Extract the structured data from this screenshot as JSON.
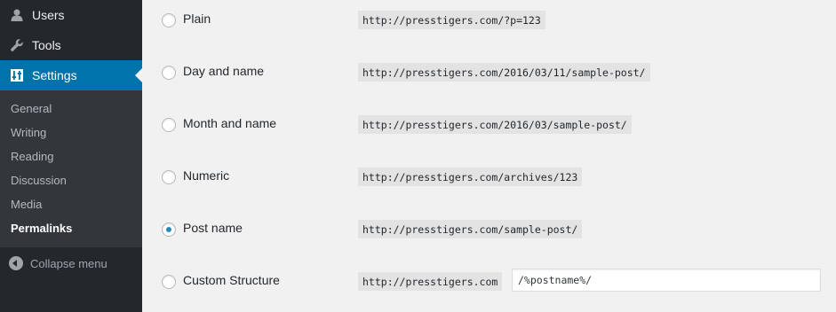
{
  "sidebar": {
    "top_items": [
      {
        "label": "Users",
        "icon": "user-icon"
      },
      {
        "label": "Tools",
        "icon": "wrench-icon"
      },
      {
        "label": "Settings",
        "icon": "settings-icon",
        "active": true
      }
    ],
    "submenu": [
      "General",
      "Writing",
      "Reading",
      "Discussion",
      "Media",
      "Permalinks"
    ],
    "current_submenu": "Permalinks",
    "collapse_label": "Collapse menu"
  },
  "permalinks": {
    "options": [
      {
        "label": "Plain",
        "example": "http://presstigers.com/?p=123",
        "checked": false
      },
      {
        "label": "Day and name",
        "example": "http://presstigers.com/2016/03/11/sample-post/",
        "checked": false
      },
      {
        "label": "Month and name",
        "example": "http://presstigers.com/2016/03/sample-post/",
        "checked": false
      },
      {
        "label": "Numeric",
        "example": "http://presstigers.com/archives/123",
        "checked": false
      },
      {
        "label": "Post name",
        "example": "http://presstigers.com/sample-post/",
        "checked": true
      },
      {
        "label": "Custom Structure",
        "example": "http://presstigers.com",
        "checked": false
      }
    ],
    "custom_value": "/%postname%/"
  },
  "colors": {
    "sidebar_bg": "#23282d",
    "submenu_bg": "#32373c",
    "active_bg": "#0073aa",
    "content_bg": "#f1f1f1",
    "radio_check": "#1e8cbe"
  }
}
